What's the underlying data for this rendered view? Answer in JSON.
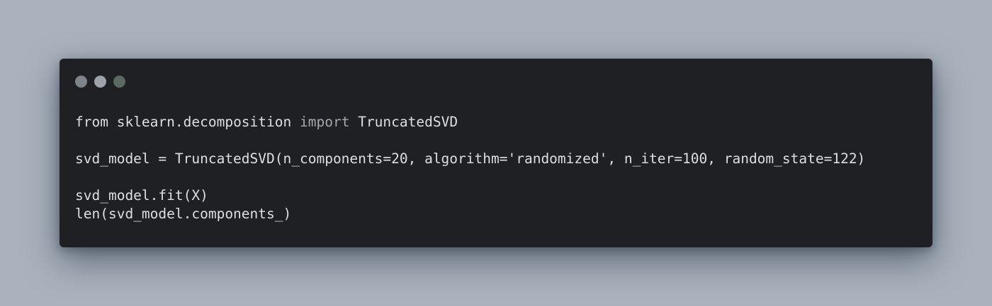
{
  "colors": {
    "background": "#a9b2bd",
    "window": "#1f2023",
    "text": "#dcdfe4",
    "keyword": "#a4a9b1",
    "dot_close": "#7e848c",
    "dot_minimize": "#9da3ab",
    "dot_maximize": "#596b60"
  },
  "window_controls": [
    {
      "name": "close",
      "icon": "circle-dot-icon"
    },
    {
      "name": "minimize",
      "icon": "circle-dot-icon"
    },
    {
      "name": "maximize",
      "icon": "circle-dot-icon"
    }
  ],
  "code": {
    "line1": {
      "from": "from",
      "module": " sklearn.decomposition ",
      "import": "import",
      "name": " TruncatedSVD"
    },
    "line2": "",
    "line3": "svd_model = TruncatedSVD(n_components=20, algorithm='randomized', n_iter=100, random_state=122)",
    "line4": "",
    "line5": "svd_model.fit(X)",
    "line6": "len(svd_model.components_)"
  }
}
